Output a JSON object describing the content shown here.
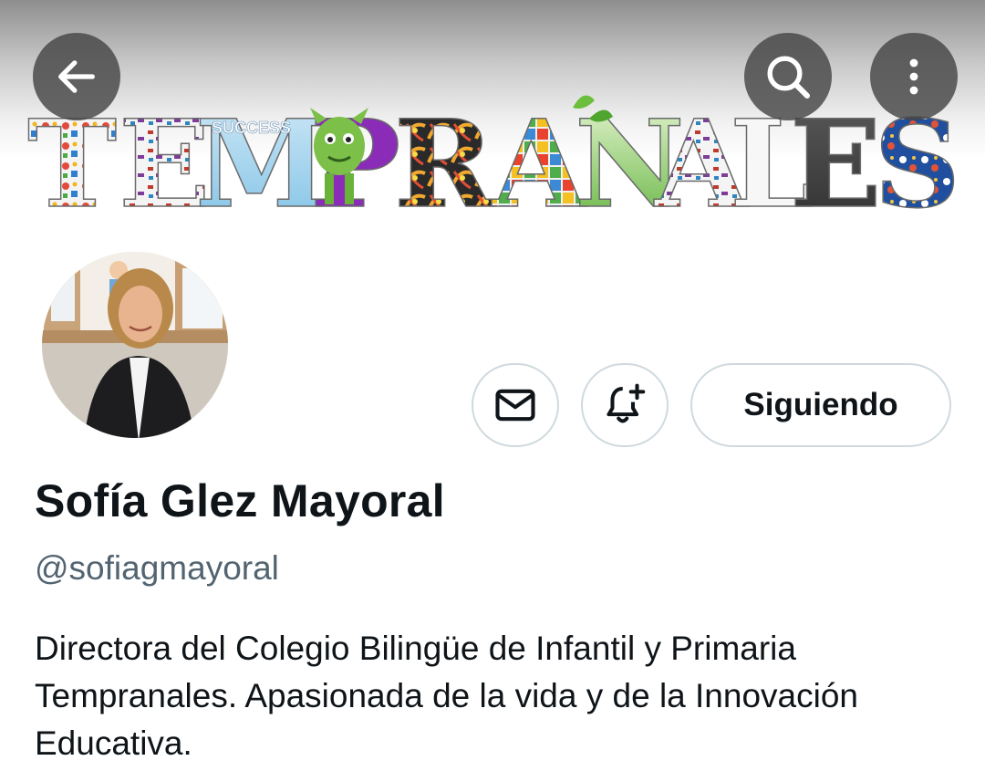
{
  "banner": {
    "word": "TEMPRANALES",
    "letters": [
      "T",
      "E",
      "M",
      "P",
      "R",
      "A",
      "N",
      "A",
      "L",
      "E",
      "S"
    ],
    "success_text": "SUCCESS"
  },
  "header": {
    "back_icon": "arrow-left-icon",
    "search_icon": "search-icon",
    "more_icon": "more-vertical-icon"
  },
  "actions": {
    "message_icon": "mail-icon",
    "notify_icon": "bell-plus-icon",
    "follow_label": "Siguiendo"
  },
  "profile": {
    "name": "Sofía Glez Mayoral",
    "handle": "@sofiagmayoral",
    "bio": [
      "Directora del Colegio Bilingüe de Infantil y Primaria",
      "Tempranales. Apasionada de la vida y de la Innovación",
      "Educativa."
    ]
  },
  "colors": {
    "text": "#0f1419",
    "secondary": "#536471",
    "border": "#cfd9de",
    "overlay_button": "#464646"
  }
}
